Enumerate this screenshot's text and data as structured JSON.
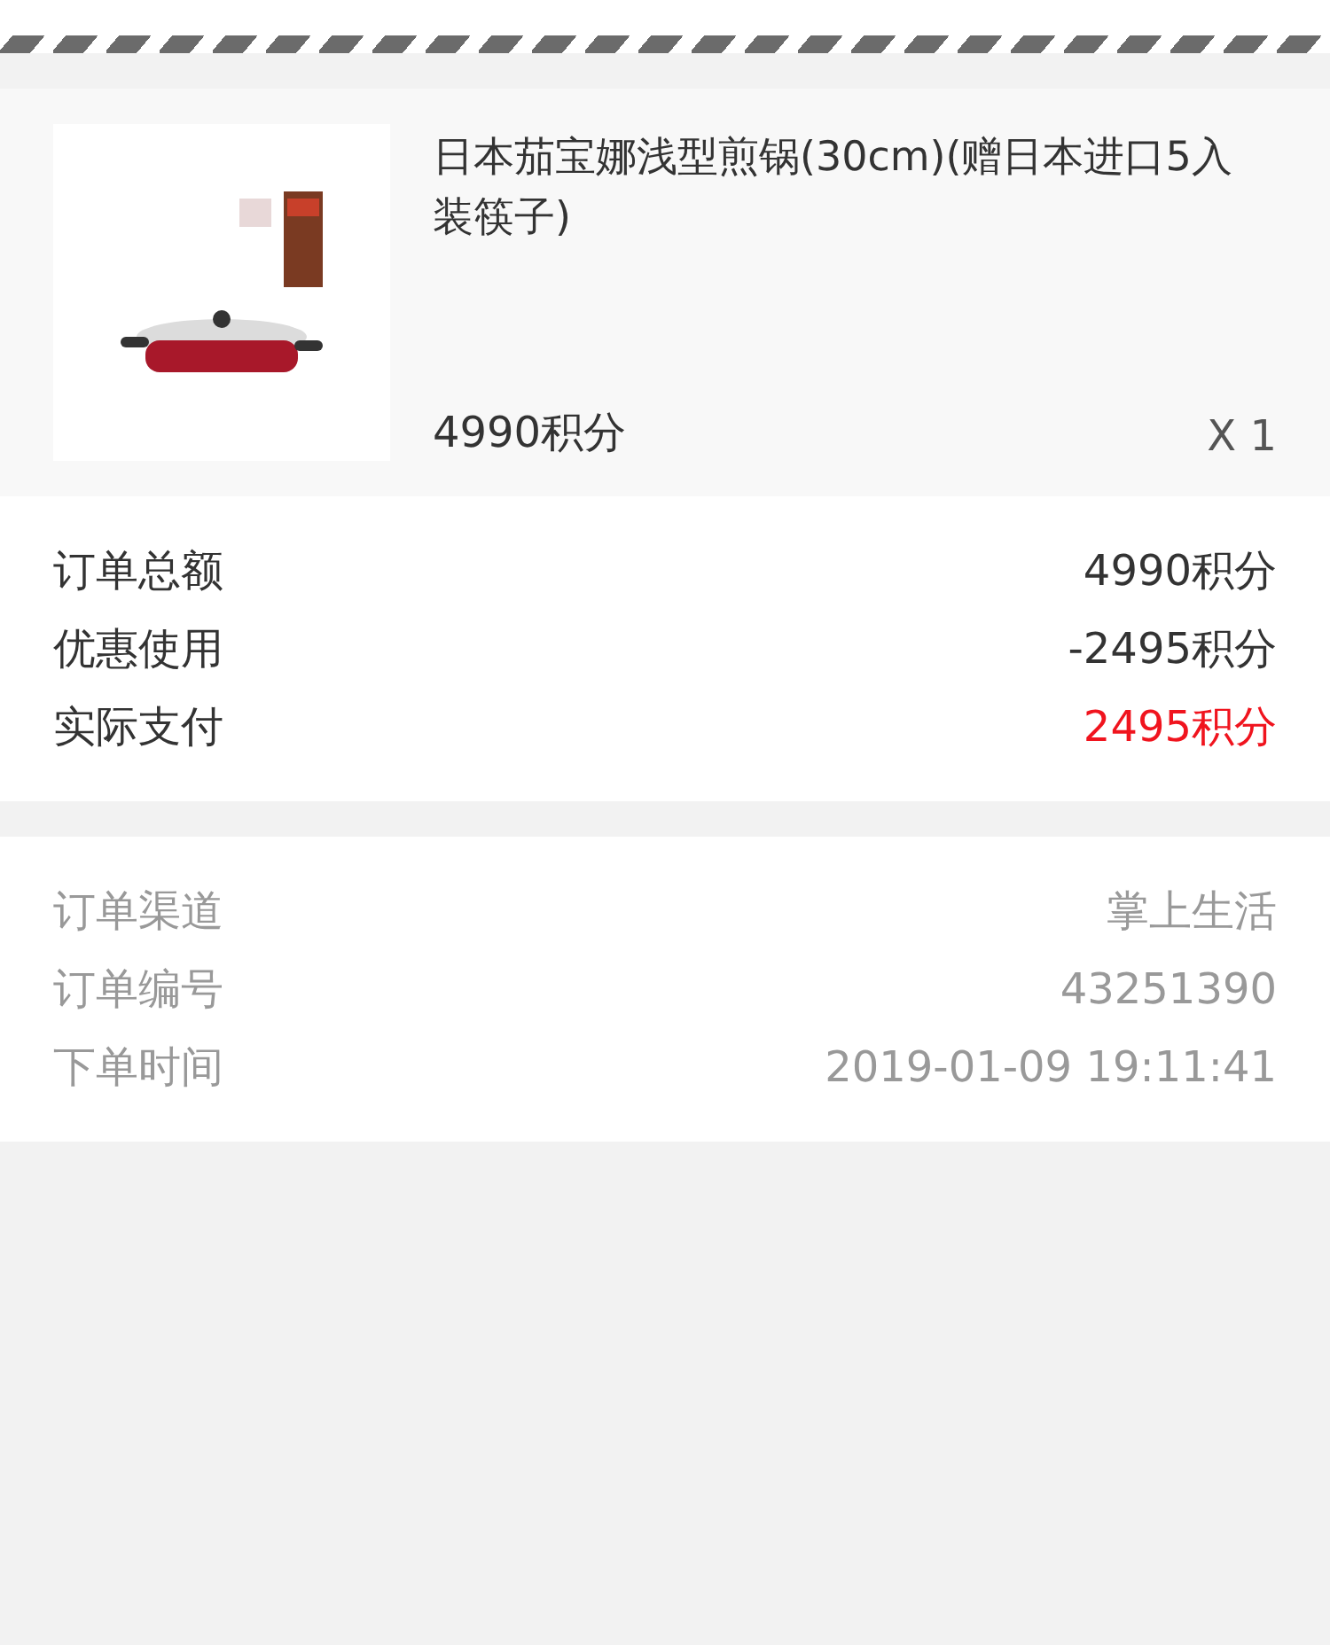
{
  "product": {
    "title": "日本茄宝娜浅型煎锅(30cm)(赠日本进口5入装筷子)",
    "price": "4990积分",
    "quantity": "X 1"
  },
  "summary": [
    {
      "label": "订单总额",
      "value": "4990积分",
      "highlight": false
    },
    {
      "label": "优惠使用",
      "value": "-2495积分",
      "highlight": false
    },
    {
      "label": "实际支付",
      "value": "2495积分",
      "highlight": true
    }
  ],
  "details": [
    {
      "label": "订单渠道",
      "value": "掌上生活"
    },
    {
      "label": "订单编号",
      "value": "43251390"
    },
    {
      "label": "下单时间",
      "value": "2019-01-09 19:11:41"
    }
  ]
}
